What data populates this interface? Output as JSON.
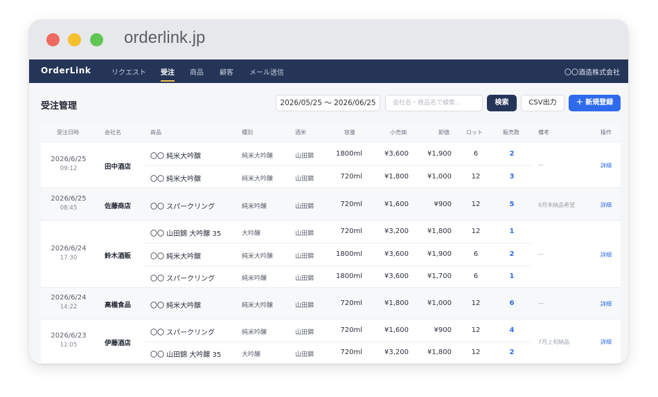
{
  "browser": {
    "url": "orderlink.jp"
  },
  "nav": {
    "brand": "OrderLink",
    "items": [
      "リクエスト",
      "受注",
      "商品",
      "顧客",
      "メール送信"
    ],
    "active_index": 1,
    "company": "〇〇酒造株式会社"
  },
  "page": {
    "title": "受注管理",
    "date_range": "2026/05/25 〜 2026/06/25",
    "search_placeholder": "会社名・商品名で検索...",
    "search_button": "検索",
    "csv_button": "CSV出力",
    "new_button": "＋ 新規登録"
  },
  "table": {
    "headers": [
      "受注日時",
      "会社名",
      "商品",
      "種別",
      "酒米",
      "容量",
      "小売価",
      "卸値",
      "ロット",
      "販売数",
      "備考",
      "操作"
    ],
    "groups": [
      {
        "date": "2026/6/25",
        "time": "09:12",
        "company": "田中酒店",
        "note": "—",
        "action": "詳細",
        "rows": [
          {
            "product": "〇〇 純米大吟醸",
            "type": "純米大吟醸",
            "rice": "山田錦",
            "volume": "1800ml",
            "retail": "¥3,600",
            "wholesale": "¥1,900",
            "lot": "6",
            "sales": "2"
          },
          {
            "product": "〇〇 純米大吟醸",
            "type": "純米大吟醸",
            "rice": "山田錦",
            "volume": "720ml",
            "retail": "¥1,800",
            "wholesale": "¥1,000",
            "lot": "12",
            "sales": "3"
          }
        ]
      },
      {
        "date": "2026/6/25",
        "time": "08:45",
        "company": "佐藤商店",
        "note": "6月末納品希望",
        "action": "詳細",
        "rows": [
          {
            "product": "〇〇 スパークリング",
            "type": "純米吟醸",
            "rice": "山田錦",
            "volume": "720ml",
            "retail": "¥1,600",
            "wholesale": "¥900",
            "lot": "12",
            "sales": "5"
          }
        ]
      },
      {
        "date": "2026/6/24",
        "time": "17:30",
        "company": "鈴木酒販",
        "note": "—",
        "action": "詳細",
        "rows": [
          {
            "product": "〇〇 山田錦 大吟醸 35",
            "type": "大吟醸",
            "rice": "山田錦",
            "volume": "720ml",
            "retail": "¥3,200",
            "wholesale": "¥1,800",
            "lot": "12",
            "sales": "1"
          },
          {
            "product": "〇〇 純米大吟醸",
            "type": "純米大吟醸",
            "rice": "山田錦",
            "volume": "1800ml",
            "retail": "¥3,600",
            "wholesale": "¥1,900",
            "lot": "6",
            "sales": "2"
          },
          {
            "product": "〇〇 スパークリング",
            "type": "純米吟醸",
            "rice": "山田錦",
            "volume": "1800ml",
            "retail": "¥3,600",
            "wholesale": "¥1,700",
            "lot": "6",
            "sales": "1"
          }
        ]
      },
      {
        "date": "2026/6/24",
        "time": "14:22",
        "company": "高橋食品",
        "note": "—",
        "action": "詳細",
        "rows": [
          {
            "product": "〇〇 純米大吟醸",
            "type": "純米大吟醸",
            "rice": "山田錦",
            "volume": "720ml",
            "retail": "¥1,800",
            "wholesale": "¥1,000",
            "lot": "12",
            "sales": "6"
          }
        ]
      },
      {
        "date": "2026/6/23",
        "time": "11:05",
        "company": "伊藤酒店",
        "note": "7月上旬納品",
        "action": "詳細",
        "rows": [
          {
            "product": "〇〇 スパークリング",
            "type": "純米吟醸",
            "rice": "山田錦",
            "volume": "720ml",
            "retail": "¥1,600",
            "wholesale": "¥900",
            "lot": "12",
            "sales": "4"
          },
          {
            "product": "〇〇 山田錦 大吟醸 35",
            "type": "大吟醸",
            "rice": "山田錦",
            "volume": "720ml",
            "retail": "¥3,200",
            "wholesale": "¥1,800",
            "lot": "12",
            "sales": "2"
          }
        ]
      }
    ]
  },
  "colors": {
    "navbar": "#243558",
    "accent": "#2f6bec",
    "active_underline": "#f2c14e"
  }
}
